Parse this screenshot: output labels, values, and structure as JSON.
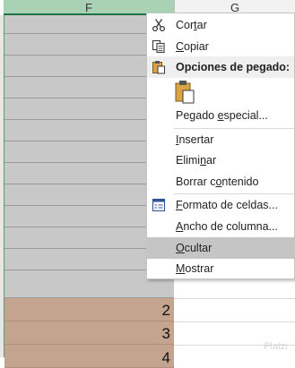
{
  "sheet": {
    "columns": [
      "F",
      "G"
    ],
    "visible_values": [
      "2",
      "3",
      "4"
    ]
  },
  "menu": {
    "items": [
      {
        "label_pre": "Cor",
        "label_u": "t",
        "label_post": "ar",
        "icon": "scissors-icon"
      },
      {
        "label_pre": "",
        "label_u": "C",
        "label_post": "opiar",
        "icon": "copy-icon"
      }
    ],
    "paste_header": "Opciones de pegado:",
    "paste_special": {
      "pre": "Pegado ",
      "u": "e",
      "post": "special..."
    },
    "insert": {
      "pre": "",
      "u": "I",
      "post": "nsertar"
    },
    "delete": {
      "pre": "Elimi",
      "u": "n",
      "post": "ar"
    },
    "clear": {
      "pre": "Borrar c",
      "u": "o",
      "post": "ntenido"
    },
    "format": {
      "pre": "",
      "u": "F",
      "post": "ormato de celdas..."
    },
    "width": {
      "pre": "",
      "u": "A",
      "post": "ncho de columna..."
    },
    "hide": {
      "pre": "",
      "u": "O",
      "post": "cultar"
    },
    "show": {
      "pre": "",
      "u": "M",
      "post": "ostrar"
    }
  },
  "colors": {
    "selected_header": "#a9d2b4",
    "selected_cells": "#c8c8c8",
    "highlight_cells": "#c4a48f",
    "menu_hover": "#c5c5c5"
  },
  "watermark": "Platzi"
}
